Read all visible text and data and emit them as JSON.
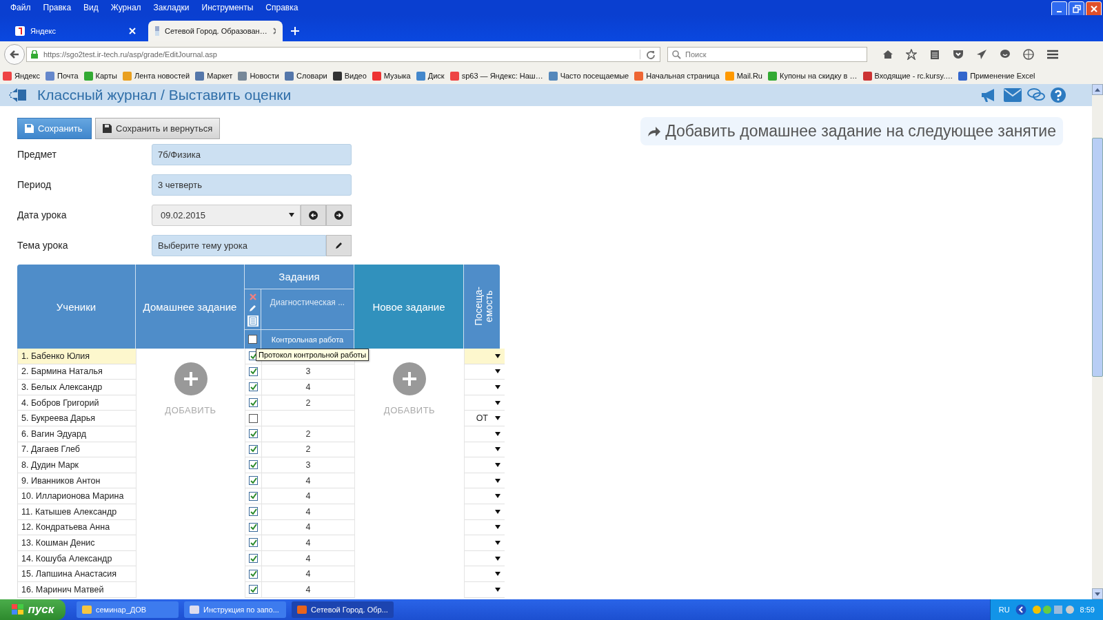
{
  "browser": {
    "menu": [
      "Файл",
      "Правка",
      "Вид",
      "Журнал",
      "Закладки",
      "Инструменты",
      "Справка"
    ],
    "tabs": [
      {
        "title": "Яндекс",
        "selected": false
      },
      {
        "title": "Сетевой Город. Образован…",
        "selected": true
      }
    ],
    "address": "https://sgo2test.ir-tech.ru/asp/grade/EditJournal.asp",
    "search": {
      "placeholder": "Поиск"
    },
    "bookmarks": [
      "Яндекс",
      "Почта",
      "Карты",
      "Лента новостей",
      "Маркет",
      "Новости",
      "Словари",
      "Видео",
      "Музыка",
      "Диск",
      "sp63 — Яндекс: Наш…",
      "Часто посещаемые",
      "Начальная страница",
      "Mail.Ru",
      "Купоны на скидку в …",
      "Входящие - rc.kursy.…",
      "Применение Excel"
    ]
  },
  "page": {
    "title": "Классный журнал / Выставить оценки",
    "buttons": [
      {
        "label": "Сохранить",
        "kind": "primary"
      },
      {
        "label": "Сохранить и вернуться",
        "kind": "default"
      }
    ],
    "homework_link": "Добавить домашнее задание на следующее занятие",
    "fields": [
      {
        "label": "Предмет",
        "kind": "text",
        "value": "7б/Физика"
      },
      {
        "label": "Период",
        "kind": "text",
        "value": "3 четверть"
      },
      {
        "label": "Дата урока",
        "kind": "date",
        "value": "09.02.2015"
      },
      {
        "label": "Тема урока",
        "kind": "picker",
        "placeholder": "Выберите тему урока"
      }
    ],
    "table": {
      "col_students": "Ученики",
      "col_homework": "Домашнее задание",
      "col_tasks": "Задания",
      "task_name": "Диагностическая ...",
      "task_type": "Контрольная работа",
      "task_all_checked": false,
      "col_new": "Новое задание",
      "col_attendance": "Посеща-емость",
      "add_homework": "ДОБАВИТЬ",
      "add_new": "ДОБАВИТЬ",
      "tooltip": "Протокол контрольной работы",
      "students": [
        {
          "name": "1. Бабенко Юлия",
          "selected": true,
          "done": true
        },
        {
          "name": "2. Бармина Наталья",
          "selected": false,
          "done": true,
          "grade": "3"
        },
        {
          "name": "3. Белых Александр",
          "selected": false,
          "done": true,
          "grade": "4"
        },
        {
          "name": "4. Бобров Григорий",
          "selected": false,
          "done": true,
          "grade": "2"
        },
        {
          "name": "5. Букреева Дарья",
          "selected": false,
          "done": false,
          "attendance": "ОТ"
        },
        {
          "name": "6. Вагин Эдуард",
          "selected": false,
          "done": true,
          "grade": "2"
        },
        {
          "name": "7. Дагаев Глеб",
          "selected": false,
          "done": true,
          "grade": "2"
        },
        {
          "name": "8. Дудин Марк",
          "selected": false,
          "done": true,
          "grade": "3"
        },
        {
          "name": "9. Иванников Антон",
          "selected": false,
          "done": true,
          "grade": "4"
        },
        {
          "name": "10. Илларионова Марина",
          "selected": false,
          "done": true,
          "grade": "4"
        },
        {
          "name": "11. Катышев Александр",
          "selected": false,
          "done": true,
          "grade": "4"
        },
        {
          "name": "12. Кондратьева Анна",
          "selected": false,
          "done": true,
          "grade": "4"
        },
        {
          "name": "13. Кошман Денис",
          "selected": false,
          "done": true,
          "grade": "4"
        },
        {
          "name": "14. Кошуба Александр",
          "selected": false,
          "done": true,
          "grade": "4"
        },
        {
          "name": "15. Лапшина Анастасия",
          "selected": false,
          "done": true,
          "grade": "4"
        },
        {
          "name": "16. Маринич Матвей",
          "selected": false,
          "done": true,
          "grade": "4"
        }
      ]
    }
  },
  "taskbar": {
    "start": "пуск",
    "items": [
      {
        "label": "семинар_ДОВ",
        "selected": false
      },
      {
        "label": "Инструкция по запо...",
        "selected": false
      },
      {
        "label": "Сетевой Город. Обр...",
        "selected": true
      }
    ],
    "lang": "RU",
    "clock": "8:59"
  }
}
